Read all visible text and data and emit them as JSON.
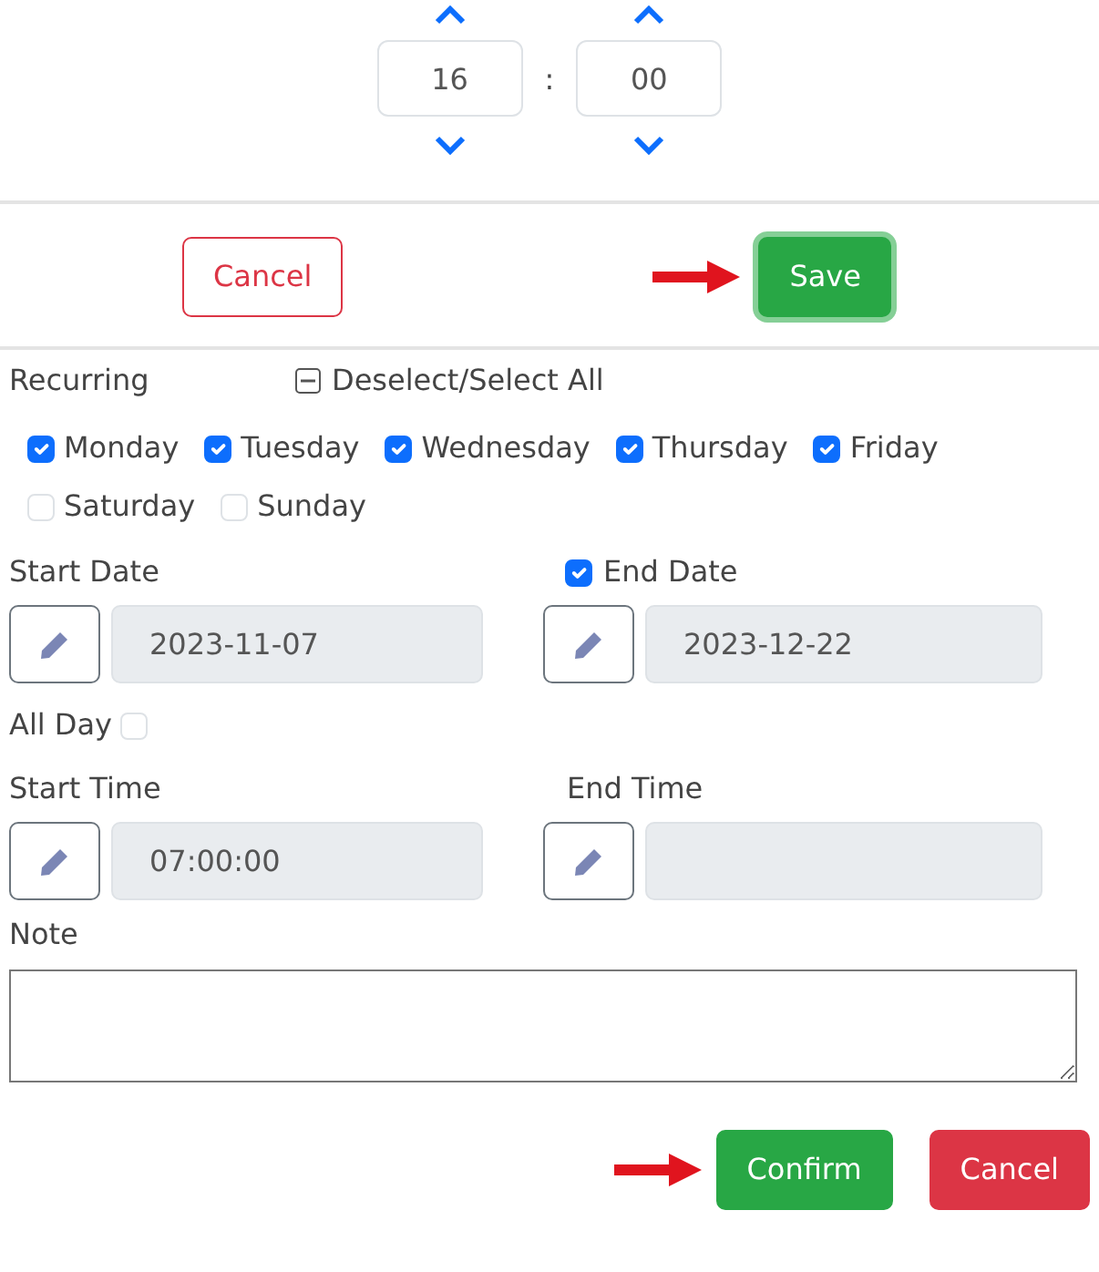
{
  "time_picker": {
    "hour": "16",
    "separator": ":",
    "minute": "00"
  },
  "actions": [
    {
      "label": "Cancel",
      "kind": "outline-danger",
      "arrow": false,
      "focused": false
    },
    {
      "label": "Save",
      "kind": "success",
      "arrow": true,
      "focused": true
    }
  ],
  "recurring": {
    "label": "Recurring",
    "toggle_all": {
      "label": "Deselect/Select All"
    },
    "days": [
      {
        "label": "Monday",
        "checked": true
      },
      {
        "label": "Tuesday",
        "checked": true
      },
      {
        "label": "Wednesday",
        "checked": true
      },
      {
        "label": "Thursday",
        "checked": true
      },
      {
        "label": "Friday",
        "checked": true
      },
      {
        "label": "Saturday",
        "checked": false
      },
      {
        "label": "Sunday",
        "checked": false
      }
    ]
  },
  "dates": [
    {
      "label": "Start Date",
      "value": "2023-11-07",
      "disabled": true
    },
    {
      "label": "End Date",
      "checked": true,
      "value": "2023-12-22",
      "disabled": true
    }
  ],
  "all_day": {
    "label": "All Day",
    "checked": false
  },
  "times": [
    {
      "label": "Start Time",
      "value": "07:00:00",
      "disabled": true
    },
    {
      "label": "End Time",
      "disabled": true
    }
  ],
  "note": {
    "label": "Note"
  },
  "footer_buttons": [
    {
      "label": "Confirm",
      "kind": "success",
      "arrow": true,
      "focused": false
    },
    {
      "label": "Cancel",
      "kind": "danger",
      "arrow": false,
      "focused": false
    }
  ]
}
